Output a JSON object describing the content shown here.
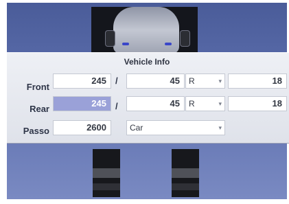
{
  "dialog": {
    "title": "Vehicle Info"
  },
  "rows": {
    "front": {
      "label": "Front",
      "width": "245",
      "separator": "/",
      "ratio": "45",
      "construction": "R",
      "rim": "18"
    },
    "rear": {
      "label": "Rear",
      "width": "245",
      "separator": "/",
      "ratio": "45",
      "construction": "R",
      "rim": "18"
    },
    "passo": {
      "label": "Passo",
      "value": "2600",
      "vehicle_type": "Car"
    }
  },
  "colors": {
    "background_gradient_top": "#4a5c99",
    "panel": "#e5e7ee",
    "highlight_field": "#9aa1d8"
  },
  "icons": {
    "dropdown_arrow": "▾"
  }
}
